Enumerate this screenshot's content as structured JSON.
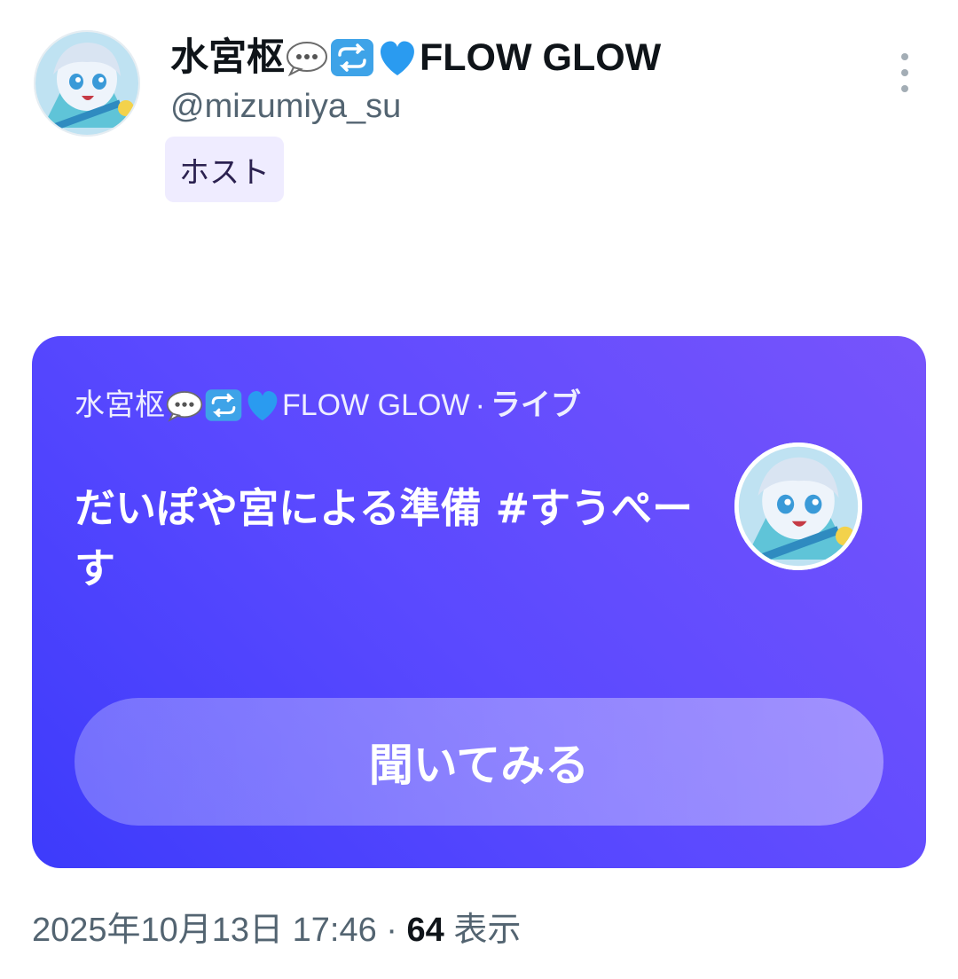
{
  "post": {
    "author": {
      "name_prefix": "水宮枢",
      "name_suffix": "FLOW GLOW",
      "handle": "@mizumiya_su",
      "name_emojis": [
        "speech-balloon-emoji",
        "repeat-emoji",
        "blue-heart-emoji"
      ]
    },
    "role_badge": "ホスト",
    "timestamp": "2025年10月13日 17:46",
    "separator": "·",
    "views_count": "64",
    "views_label": "表示"
  },
  "space_card": {
    "host_name_prefix": "水宮枢",
    "host_name_suffix": "FLOW GLOW",
    "separator": "·",
    "status": "ライブ",
    "title": "だいぽや宮による準備 #すうぺーす",
    "listen_label": "聞いてみる",
    "gradient": [
      "#3d3bfb",
      "#7754fb"
    ]
  },
  "colors": {
    "text_secondary": "#536471",
    "badge_bg": "#efecff",
    "accent": "#5a49ff"
  }
}
